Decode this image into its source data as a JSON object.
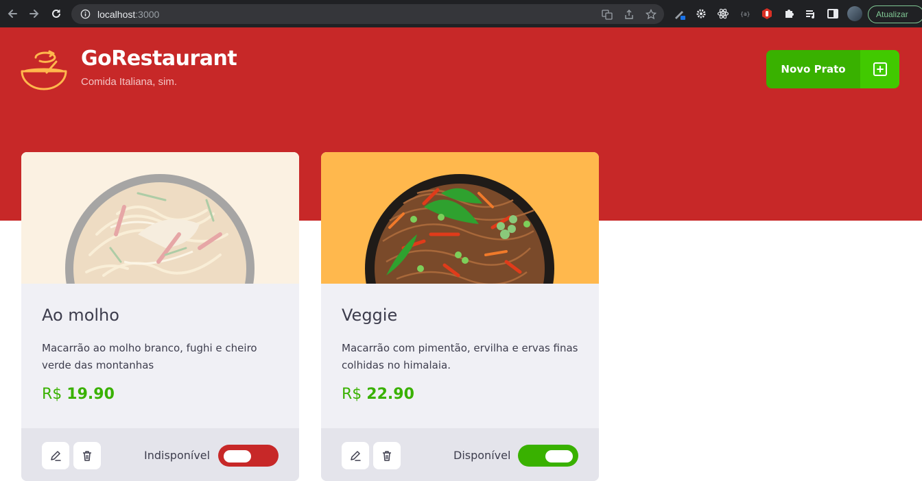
{
  "browser": {
    "url_host": "localhost",
    "url_port": ":3000",
    "update_label": "Atualizar"
  },
  "header": {
    "brand_name": "GoRestaurant",
    "tagline": "Comida Italiana, sim.",
    "new_dish_label": "Novo Prato"
  },
  "colors": {
    "header_bg": "#c72828",
    "accent_green": "#39b100",
    "card_bg": "#f0f0f5",
    "card_footer_bg": "#e4e4eb",
    "text_dark": "#3d3d4d"
  },
  "foods": [
    {
      "name": "Ao molho",
      "description": "Macarrão ao molho branco, fughi e cheiro verde das montanhas",
      "currency": "R$",
      "price": "19.90",
      "availability_label": "Indisponível",
      "available": false,
      "image_bg": "#f6dfbf",
      "image_icon": "pasta-bowl-icon"
    },
    {
      "name": "Veggie",
      "description": "Macarrão com pimentão, ervilha e ervas finas colhidas no himalaia.",
      "currency": "R$",
      "price": "22.90",
      "availability_label": "Disponível",
      "available": true,
      "image_bg": "#ffb84d",
      "image_icon": "noodle-bowl-icon"
    }
  ]
}
